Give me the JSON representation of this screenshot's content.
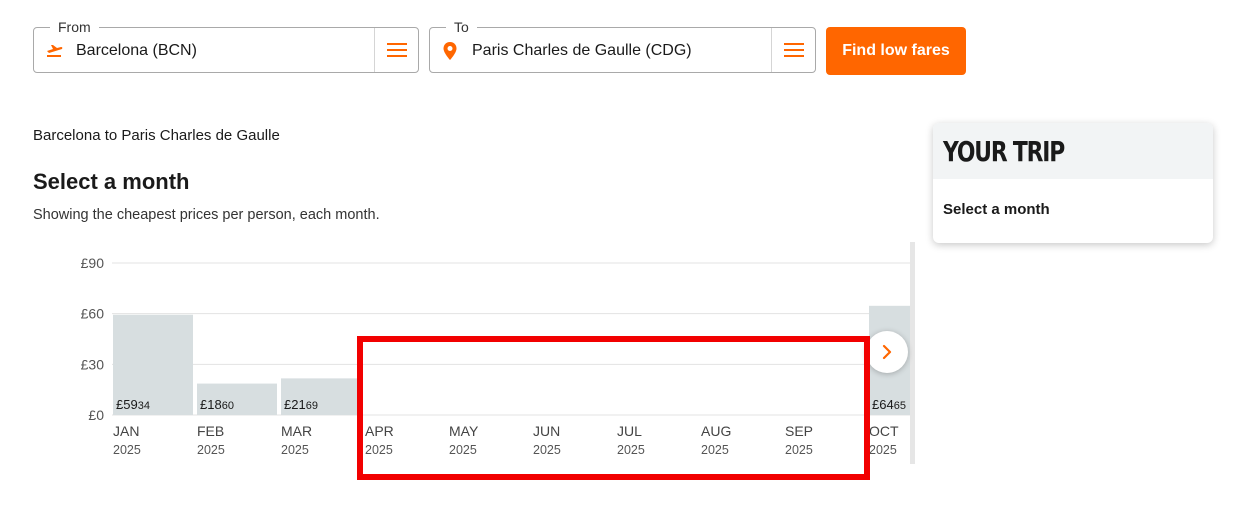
{
  "search": {
    "from": {
      "legend": "From",
      "value": "Barcelona (BCN)",
      "icon": "plane-takeoff-icon"
    },
    "to": {
      "legend": "To",
      "value": "Paris Charles de Gaulle (CDG)",
      "icon": "location-pin-icon"
    },
    "submit_label": "Find low fares"
  },
  "route_title": "Barcelona to Paris Charles de Gaulle",
  "heading": "Select a month",
  "subheading": "Showing the cheapest prices per person, each month.",
  "colors": {
    "accent": "#ff6600",
    "bar": "#d7dee0",
    "highlight": "#f20000"
  },
  "chart_data": {
    "type": "bar",
    "currency": "£",
    "y_ticks": [
      "£90",
      "£60",
      "£30",
      "£0"
    ],
    "ylim": [
      0,
      90
    ],
    "grid": true,
    "categories": [
      {
        "month": "JAN",
        "year": "2025",
        "price_whole": "£59",
        "price_pence": ".34",
        "value": 59.34
      },
      {
        "month": "FEB",
        "year": "2025",
        "price_whole": "£18",
        "price_pence": ".60",
        "value": 18.6
      },
      {
        "month": "MAR",
        "year": "2025",
        "price_whole": "£21",
        "price_pence": ".69",
        "value": 21.69
      },
      {
        "month": "APR",
        "year": "2025",
        "price_whole": "",
        "price_pence": "",
        "value": null
      },
      {
        "month": "MAY",
        "year": "2025",
        "price_whole": "",
        "price_pence": "",
        "value": null
      },
      {
        "month": "JUN",
        "year": "2025",
        "price_whole": "",
        "price_pence": "",
        "value": null
      },
      {
        "month": "JUL",
        "year": "2025",
        "price_whole": "",
        "price_pence": "",
        "value": null
      },
      {
        "month": "AUG",
        "year": "2025",
        "price_whole": "",
        "price_pence": "",
        "value": null
      },
      {
        "month": "SEP",
        "year": "2025",
        "price_whole": "",
        "price_pence": "",
        "value": null
      },
      {
        "month": "OCT",
        "year": "2025",
        "price_whole": "£64",
        "price_pence": ".65",
        "value": 64.65
      }
    ]
  },
  "trip_panel": {
    "title": "YOUR TRIP",
    "body": "Select a month"
  }
}
